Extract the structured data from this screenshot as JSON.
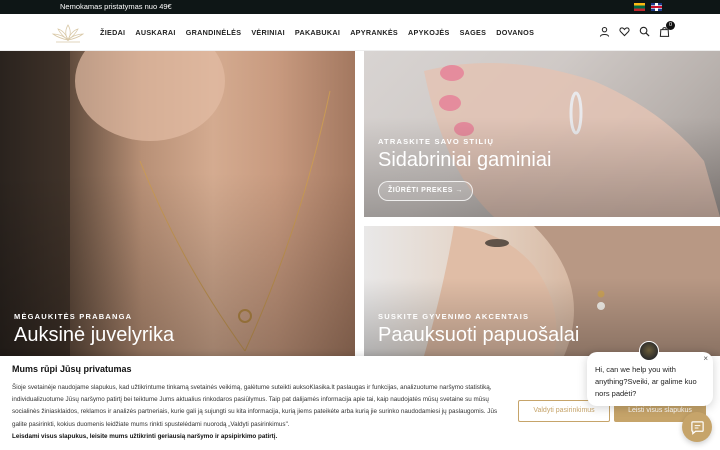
{
  "topbar": {
    "promo": "Nemokamas pristatymas nuo 49€",
    "languages": [
      "lt",
      "en"
    ]
  },
  "header": {
    "nav": [
      "ŽIEDAI",
      "AUSKARAI",
      "GRANDINĖLĖS",
      "VĖRINIAI",
      "PAKABUKAI",
      "APYRANKĖS",
      "APYKOJĖS",
      "SAGES",
      "DOVANOS"
    ],
    "cart_count": "0",
    "icons": [
      "user-icon",
      "heart-icon",
      "search-icon",
      "bag-icon"
    ]
  },
  "hero": {
    "left": {
      "label": "MĖGAUKITĖS PRABANGA",
      "title": "Auksinė juvelyrika"
    },
    "top_right": {
      "label": "ATRASKITE SAVO STILIŲ",
      "title": "Sidabriniai gaminiai",
      "button": "ŽIŪRĖTI PREKES  →"
    },
    "bottom_right": {
      "label": "SUSKITE GYVENIMO AKCENTAIS",
      "title": "Paauksuoti papuošalai"
    }
  },
  "cookie": {
    "title": "Mums rūpi Jūsų privatumas",
    "text": "Šioje svetainėje naudojame slapukus, kad užtikrintume tinkamą svetainės veikimą, galėtume suteikti auksoKlasika.lt paslaugas ir funkcijas, analizuotume naršymo statistiką, individualizuotume Jūsų naršymo patirtį bei teiktume Jums aktualius rinkodaros pasiūlymus. Taip pat dalijamės informacija apie tai, kaip naudojatės mūsų svetaine su mūsų socialinės žiniasklaidos, reklamos ir analizės partneriais, kurie gali ją sujungti su kita informacija, kurią jiems pateikėte arba kurią jie surinko naudodamiesi jų paslaugomis. Jūs galite pasirinkti, kokius duomenis leidžiate mums rinkti spustelėdami nuorodą „Valdyti pasirinkimus\".",
    "bold_line": "Leisdami visus slapukus, leisite mums užtikrinti geriausią naršymo ir apsipirkimo patirtį.",
    "manage_button": "Valdyti pasirinkimus",
    "accept_button": "Leisti visus slapukus"
  },
  "chat": {
    "message": "Hi, can we help you with anything?Sveiki, ar galime kuo nors padėti?",
    "close": "×"
  },
  "colors": {
    "accent": "#c6a46a",
    "topbar": "#0e1616"
  }
}
